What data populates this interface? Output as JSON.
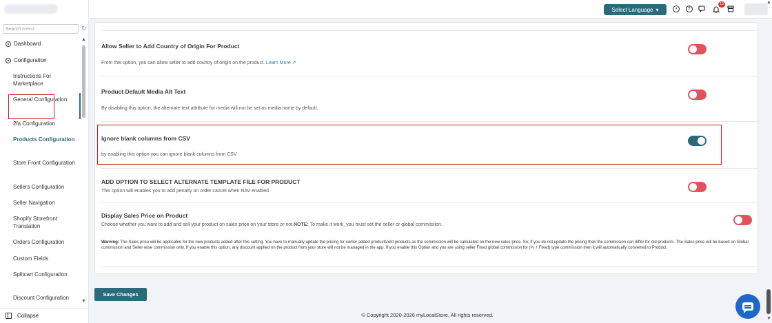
{
  "sidebar": {
    "search_placeholder": "Search menu",
    "refresh_icon": "refresh-icon",
    "items": [
      {
        "label": "Dashboard",
        "icon": "dashboard-icon"
      },
      {
        "label": "Configuration",
        "icon": "gear-icon"
      },
      {
        "label": "Instructions For Marketplace"
      },
      {
        "label": "General Configuration"
      },
      {
        "label": "2fa Configuration"
      },
      {
        "label": "Products Configuration",
        "active": true
      },
      {
        "label": "Store Front Configuration"
      },
      {
        "label": "Sellers Configuration"
      },
      {
        "label": "Seller Navigation"
      },
      {
        "label": "Shopify Storefront Translation"
      },
      {
        "label": "Orders Configuration"
      },
      {
        "label": "Custom Fields"
      },
      {
        "label": "Splitcart Configuration"
      },
      {
        "label": "Discount Configuration"
      }
    ],
    "collapse_label": "Collapse"
  },
  "topbar": {
    "language_button": "Select Language",
    "language_caret": "▾",
    "notification_count": "10"
  },
  "settings": [
    {
      "title": "Allow Seller to Add Country of Origin For Product",
      "description": "From this option, you can allow seller to add country of origin on the product.",
      "link": "Learn More ↗",
      "enabled": false
    },
    {
      "title": "Product Default Media Alt Text",
      "description": "By disabling this option, the alternate text attribute for media will not be set as media name by default.",
      "enabled": false
    },
    {
      "title": "Ignore blank columns from CSV",
      "description": "by enabling this option you can ignore blank columns from CSV",
      "enabled": true
    },
    {
      "title": "ADD OPTION TO SELECT ALTERNATE TEMPLATE FILE FOR PRODUCT",
      "description": "This option will enables you to add penalty on order cancel when NAV enabled",
      "enabled": false
    },
    {
      "title": "Display Sales Price on Product",
      "description": "Choose whether you want to add and sell your product on sales price on your store or not.",
      "note_label": "NOTE:",
      "note_text": " To make it work, you must set the seller or global commission.",
      "enabled": false
    }
  ],
  "warning": {
    "label": "Warning:",
    "text": " The Sales price will be applicable for the new products added after this setting. You have to manually update the pricing for earlier added products/old products as the commission will be calculated on the new sales price. So, if you do not update the pricing then the commission can differ for old products. The Sales price will be based on Global commission and Seller wise commission only. If you enable this option, any discount applied on the product from your store will not be managed in the app. If you enable this Option and you are using seller Fixed global commission for (% + Fixed) type commission then it will automatically converted to Product."
  },
  "save_button": "Save Changes",
  "footer": "© Copyright 2020-2026 myLocalStore, All rights reserved.",
  "colors": {
    "primary": "#2b6a7a",
    "toggle_off": "#e0535c",
    "highlight": "#d0141d",
    "link": "#2a7abf",
    "chat": "#1f66c6"
  }
}
